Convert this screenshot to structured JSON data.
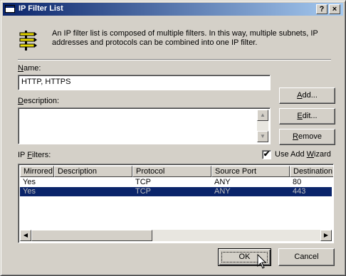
{
  "window": {
    "title": "IP Filter List",
    "help_button": "?",
    "close_button": "×"
  },
  "info_text": "An IP filter list is composed of multiple filters. In this way, multiple subnets, IP addresses and protocols can be combined into one IP filter.",
  "name": {
    "label_prefix": "",
    "label_underline": "N",
    "label_rest": "ame:",
    "value": "HTTP, HTTPS"
  },
  "description": {
    "label_prefix": "",
    "label_underline": "D",
    "label_rest": "escription:",
    "value": ""
  },
  "buttons": {
    "add_underline": "A",
    "add_rest": "dd...",
    "edit_underline": "E",
    "edit_rest": "dit...",
    "remove_underline": "R",
    "remove_rest": "emove",
    "ok": "OK",
    "cancel": "Cancel"
  },
  "ip_filters": {
    "label_prefix": "IP ",
    "label_underline": "F",
    "label_rest": "ilters:",
    "use_wizard_prefix": "Use Add ",
    "use_wizard_underline": "W",
    "use_wizard_rest": "izard",
    "use_wizard_checked": "✔",
    "columns": [
      "Mirrored",
      "Description",
      "Protocol",
      "Source Port",
      "Destination"
    ],
    "rows": [
      {
        "mirrored": "Yes",
        "description": "",
        "protocol": "TCP",
        "source_port": "ANY",
        "destination": "80"
      },
      {
        "mirrored": "Yes",
        "description": "",
        "protocol": "TCP",
        "source_port": "ANY",
        "destination": "443"
      }
    ]
  },
  "colors": {
    "title_active": "#0a246a",
    "selection": "#0a246a",
    "face": "#d4d0c8"
  }
}
